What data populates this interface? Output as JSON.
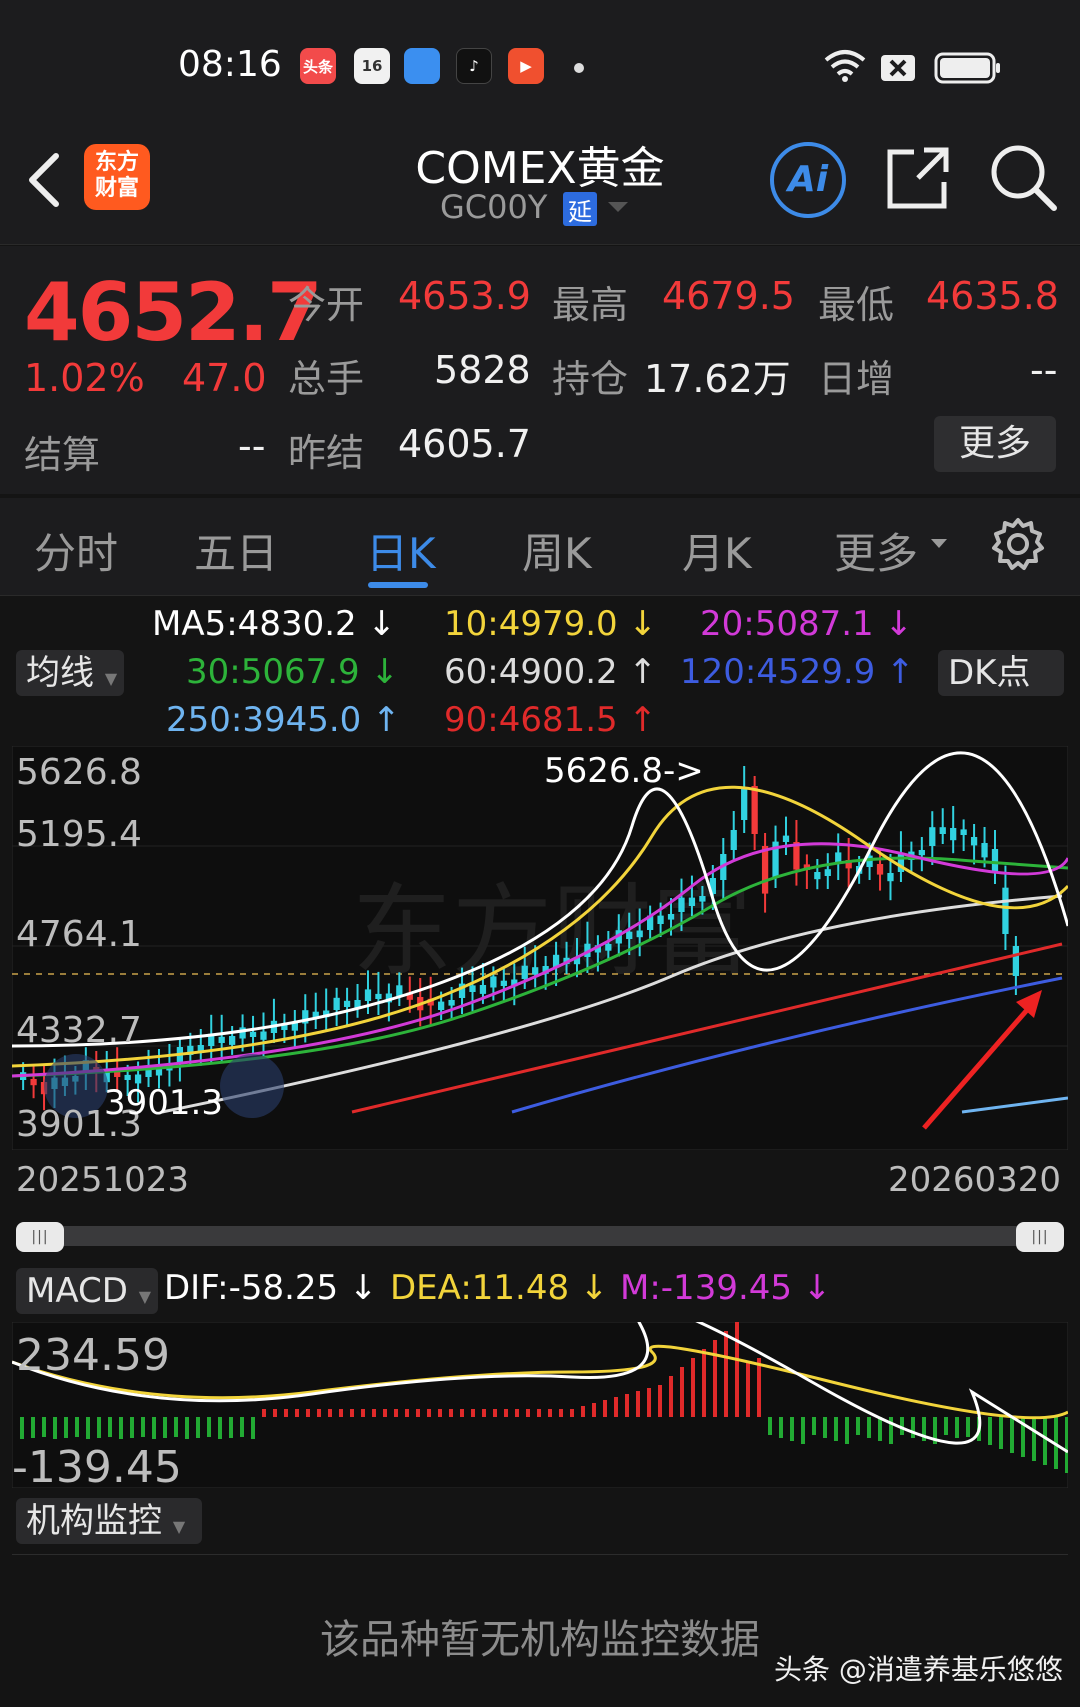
{
  "status_bar": {
    "time": "08:16",
    "apps": [
      {
        "name": "toutiao",
        "label": "头条",
        "color": "#f24b4b"
      },
      {
        "name": "calendar",
        "label": "16",
        "color": "#f1f1f1"
      },
      {
        "name": "browser",
        "label": "",
        "color": "#3b8ff0"
      },
      {
        "name": "tiktok",
        "label": "♪",
        "color": "#111111"
      },
      {
        "name": "video",
        "label": "▶",
        "color": "#f0502f"
      }
    ]
  },
  "header": {
    "logo_line1": "东方",
    "logo_line2": "财富",
    "title": "COMEX黄金",
    "subtitle": "GC00Y",
    "delay_badge": "延",
    "ai_label": "Ai"
  },
  "quote": {
    "price": "4652.7",
    "change_pct": "1.02%",
    "change": "47.0",
    "open_label": "今开",
    "open": "4653.9",
    "high_label": "最高",
    "high": "4679.5",
    "low_label": "最低",
    "low": "4635.8",
    "volume_label": "总手",
    "volume": "5828",
    "oi_label": "持仓",
    "oi": "17.62万",
    "daily_inc_label": "日增",
    "daily_inc": "--",
    "settle_label": "结算",
    "settle": "--",
    "prev_settle_label": "昨结",
    "prev_settle": "4605.7",
    "more_label": "更多"
  },
  "tabs": {
    "items": [
      "分时",
      "五日",
      "日K",
      "周K",
      "月K",
      "更多"
    ],
    "active": "日K"
  },
  "ma": {
    "chip_label": "均线",
    "dk_label": "DK点",
    "ma5": "MA5:4830.2",
    "ma10": "10:4979.0",
    "ma20": "20:5087.1",
    "ma30": "30:5067.9",
    "ma60": "60:4900.2",
    "ma120": "120:4529.9",
    "ma250": "250:3945.0",
    "ma90": "90:4681.5",
    "colors": {
      "ma5": "#ffffff",
      "ma10": "#f2d43b",
      "ma20": "#d23ad8",
      "ma30": "#2db33a",
      "ma60": "#dddddd",
      "ma120": "#3d5ce0",
      "ma250": "#6fb4f0",
      "ma90": "#e02a2a"
    }
  },
  "kchart": {
    "y_labels": [
      "5626.8",
      "5195.4",
      "4764.1",
      "4332.7",
      "3901.3"
    ],
    "max_label": "5626.8->",
    "min_label": "3901.3",
    "start_date": "20251023",
    "end_date": "20260320",
    "watermark": "东方财富",
    "up_color": "#f23a3a",
    "down_color": "#31d2e0"
  },
  "macd": {
    "chip_label": "MACD",
    "dif": "DIF:-58.25",
    "dea": "DEA:11.48",
    "m": "M:-139.45",
    "y_top": "234.59",
    "y_bottom": "-139.45",
    "colors": {
      "dif": "#ffffff",
      "dea": "#f2d43b",
      "m": "#d23ad8"
    }
  },
  "institutional": {
    "chip_label": "机构监控",
    "empty_message": "该品种暂无机构监控数据"
  },
  "watermark_credit": "头条 @消遣养基乐悠悠"
}
